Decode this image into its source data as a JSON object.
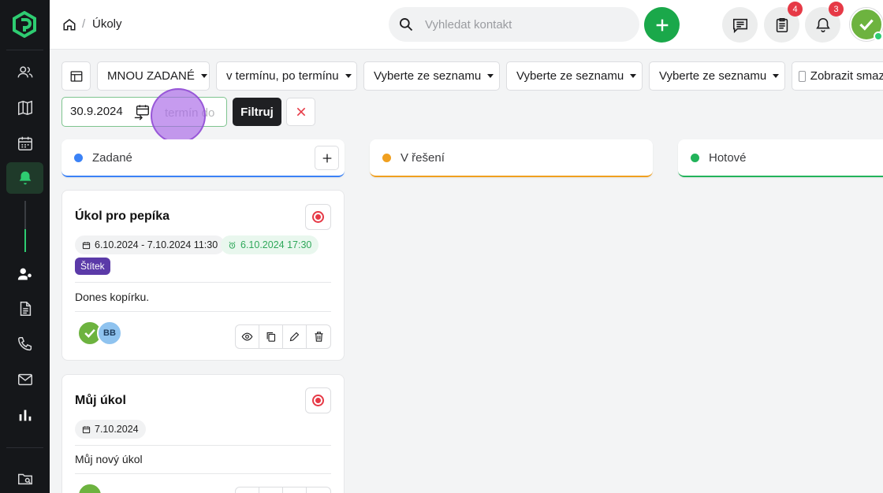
{
  "app": {
    "brand_color": "#1aa84a",
    "accent_purple": "#5b3aa8",
    "alert_red": "#e63946"
  },
  "sidebar": {
    "items": [
      {
        "name": "contacts",
        "icon": "users-icon"
      },
      {
        "name": "map",
        "icon": "map-icon"
      },
      {
        "name": "calendar",
        "icon": "calendar-icon"
      },
      {
        "name": "tasks",
        "icon": "bell-icon",
        "active": true
      },
      {
        "name": "user-settings",
        "icon": "user-key-icon"
      },
      {
        "name": "documents",
        "icon": "document-icon"
      },
      {
        "name": "calls",
        "icon": "phone-icon"
      },
      {
        "name": "mail",
        "icon": "mail-icon"
      },
      {
        "name": "stats",
        "icon": "bar-chart-icon"
      },
      {
        "name": "files",
        "icon": "folder-search-icon"
      }
    ]
  },
  "header": {
    "breadcrumb_sep": "/",
    "title": "Úkoly",
    "search_placeholder": "Vyhledat kontakt",
    "tasks_badge": "4",
    "notifications_badge": "3"
  },
  "filters": {
    "assigned": "MNOU ZADANÉ",
    "term": "v termínu, po termínu",
    "select1": "Vyberte ze seznamu",
    "select2": "Vyberte ze seznamu",
    "select3": "Vyberte ze seznamu",
    "show_deleted": "Zobrazit smaz",
    "date_from": "30.9.2024",
    "date_to_placeholder": "termín do",
    "filter_button": "Filtruj"
  },
  "columns": [
    {
      "title": "Zadané",
      "color": "#3b82f6"
    },
    {
      "title": "V řešení",
      "color": "#f0a020"
    },
    {
      "title": "Hotové",
      "color": "#22b35a"
    }
  ],
  "cards": [
    {
      "title": "Úkol pro pepíka",
      "date_range": "6.10.2024 - 7.10.2024 11:30",
      "reminder": "6.10.2024 17:30",
      "tag": "Štítek",
      "description": "Dones kopírku.",
      "assignee_initials": "BB"
    },
    {
      "title": "Můj úkol",
      "date_range": "7.10.2024",
      "description": "Můj nový úkol"
    }
  ]
}
